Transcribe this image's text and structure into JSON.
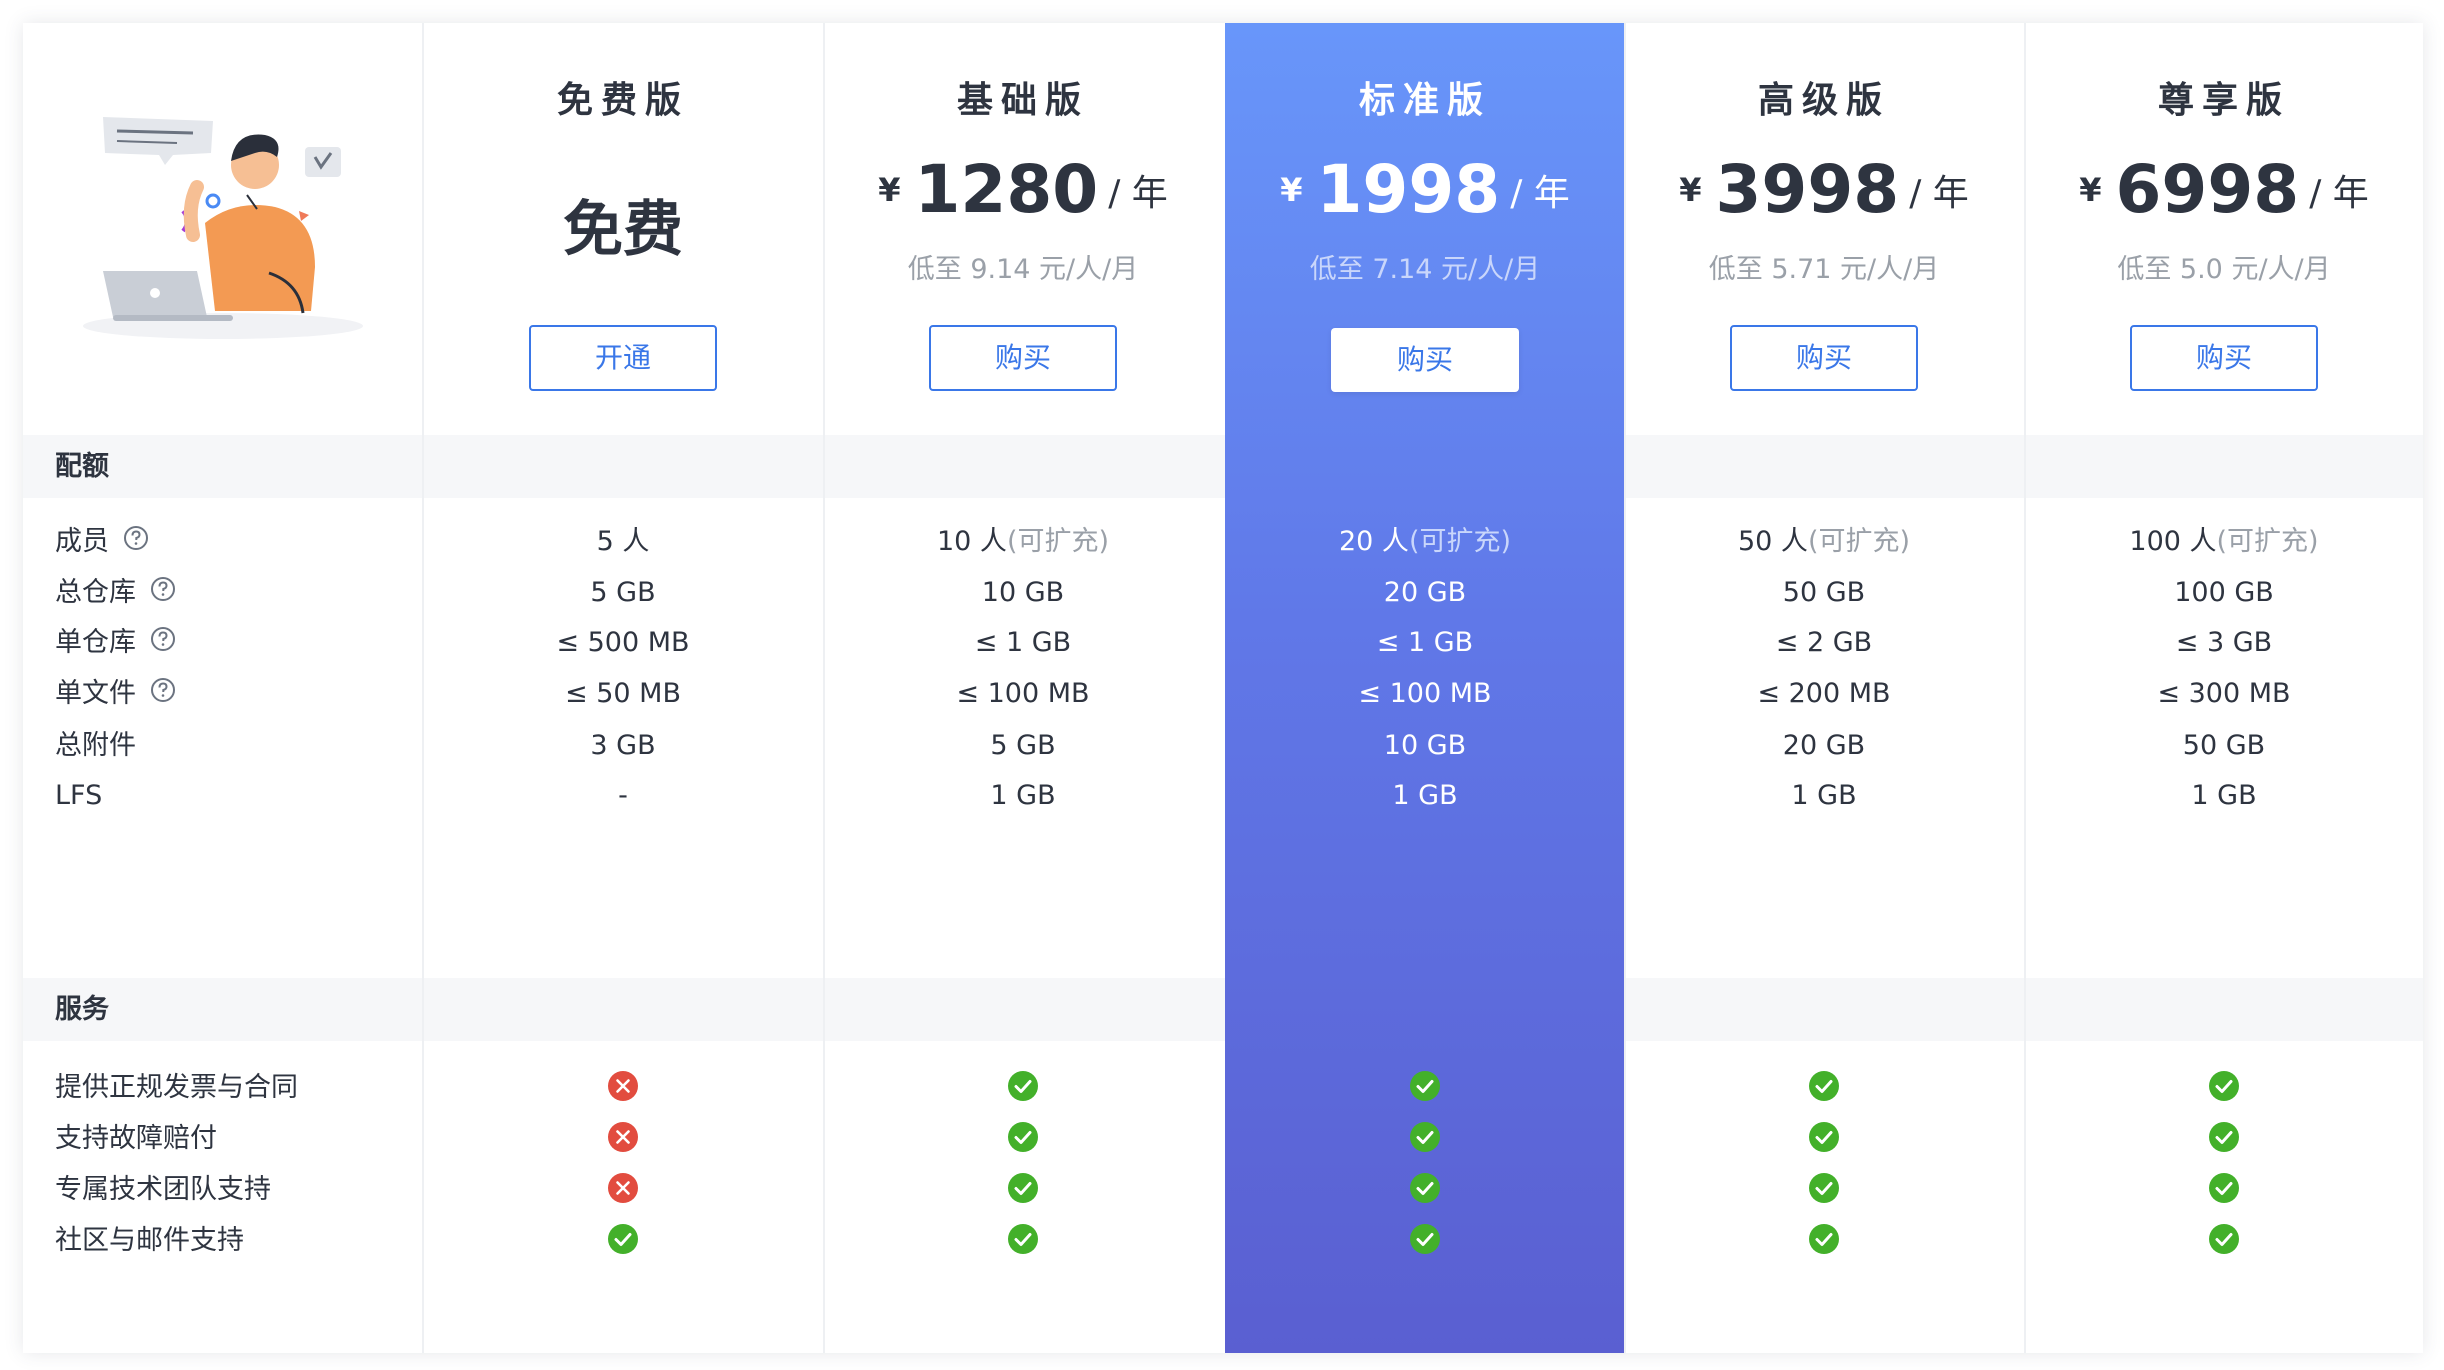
{
  "plans": [
    {
      "name": "免费版",
      "free_label": "免费",
      "button": "开通"
    },
    {
      "name": "基础版",
      "currency": "¥",
      "amount": "1280",
      "period": "/ 年",
      "unit_price": "低至 9.14 元/人/月",
      "button": "购买"
    },
    {
      "name": "标准版",
      "currency": "¥",
      "amount": "1998",
      "period": "/ 年",
      "unit_price": "低至 7.14 元/人/月",
      "button": "购买",
      "featured": true
    },
    {
      "name": "高级版",
      "currency": "¥",
      "amount": "3998",
      "period": "/ 年",
      "unit_price": "低至 5.71 元/人/月",
      "button": "购买"
    },
    {
      "name": "尊享版",
      "currency": "¥",
      "amount": "6998",
      "period": "/ 年",
      "unit_price": "低至 5.0 元/人/月",
      "button": "购买"
    }
  ],
  "quota": {
    "title": "配额",
    "rows": [
      {
        "label": "成员",
        "help": true,
        "values": [
          {
            "main": "5 人",
            "note": ""
          },
          {
            "main": "10 人",
            "note": "(可扩充)"
          },
          {
            "main": "20 人",
            "note": "(可扩充)"
          },
          {
            "main": "50 人",
            "note": "(可扩充)"
          },
          {
            "main": "100 人",
            "note": "(可扩充)"
          }
        ]
      },
      {
        "label": "总仓库",
        "help": true,
        "values": [
          {
            "main": "5 GB",
            "note": ""
          },
          {
            "main": "10 GB",
            "note": ""
          },
          {
            "main": "20 GB",
            "note": ""
          },
          {
            "main": "50 GB",
            "note": ""
          },
          {
            "main": "100 GB",
            "note": ""
          }
        ]
      },
      {
        "label": "单仓库",
        "help": true,
        "values": [
          {
            "main": "≤ 500 MB",
            "note": ""
          },
          {
            "main": "≤ 1 GB",
            "note": ""
          },
          {
            "main": "≤ 1 GB",
            "note": ""
          },
          {
            "main": "≤ 2 GB",
            "note": ""
          },
          {
            "main": "≤ 3 GB",
            "note": ""
          }
        ]
      },
      {
        "label": "单文件",
        "help": true,
        "values": [
          {
            "main": "≤ 50 MB",
            "note": ""
          },
          {
            "main": "≤ 100 MB",
            "note": ""
          },
          {
            "main": "≤ 100 MB",
            "note": ""
          },
          {
            "main": "≤ 200 MB",
            "note": ""
          },
          {
            "main": "≤ 300 MB",
            "note": ""
          }
        ]
      },
      {
        "label": "总附件",
        "help": false,
        "values": [
          {
            "main": "3 GB",
            "note": ""
          },
          {
            "main": "5 GB",
            "note": ""
          },
          {
            "main": "10 GB",
            "note": ""
          },
          {
            "main": "20 GB",
            "note": ""
          },
          {
            "main": "50 GB",
            "note": ""
          }
        ]
      },
      {
        "label": "LFS",
        "help": false,
        "values": [
          {
            "main": "-",
            "note": ""
          },
          {
            "main": "1 GB",
            "note": ""
          },
          {
            "main": "1 GB",
            "note": ""
          },
          {
            "main": "1 GB",
            "note": ""
          },
          {
            "main": "1 GB",
            "note": ""
          }
        ]
      }
    ]
  },
  "services": {
    "title": "服务",
    "rows": [
      {
        "label": "提供正规发票与合同",
        "values": [
          false,
          true,
          true,
          true,
          true
        ]
      },
      {
        "label": "支持故障赔付",
        "values": [
          false,
          true,
          true,
          true,
          true
        ]
      },
      {
        "label": "专属技术团队支持",
        "values": [
          false,
          true,
          true,
          true,
          true
        ]
      },
      {
        "label": "社区与邮件支持",
        "values": [
          true,
          true,
          true,
          true,
          true
        ]
      }
    ]
  },
  "colors": {
    "accent": "#3a77e8",
    "check": "#43b02a",
    "cross": "#e24c3f",
    "featured_top": "#6896fa",
    "featured_bottom": "#5a5fd1"
  }
}
